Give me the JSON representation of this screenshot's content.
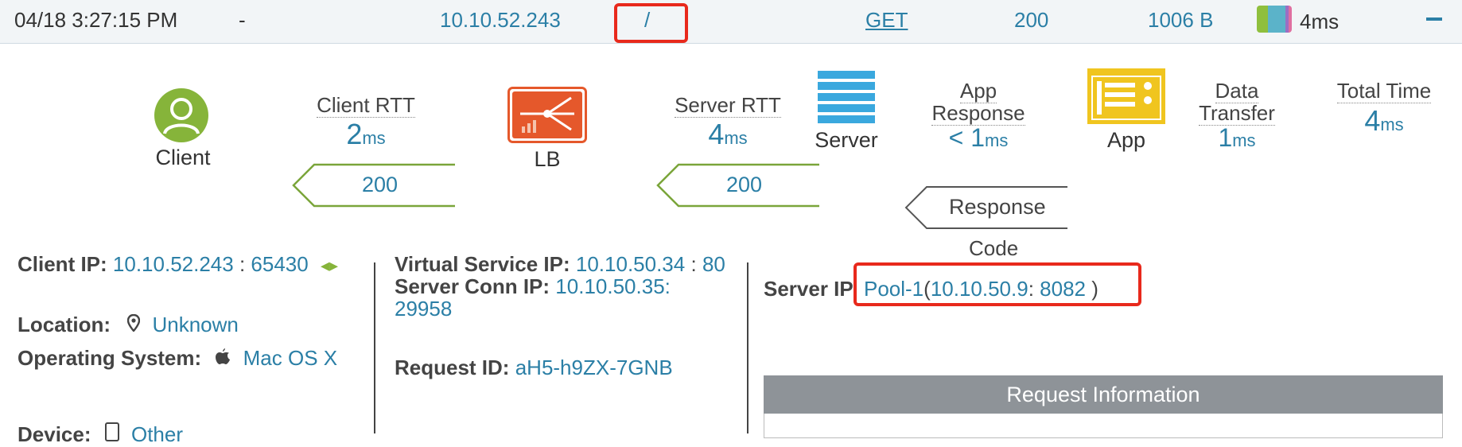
{
  "log_row": {
    "timestamp": "04/18 3:27:15 PM",
    "dash": "-",
    "client_ip": "10.10.52.243",
    "uri": "/",
    "method": "GET",
    "status": "200",
    "size": "1006 B",
    "duration": "4ms",
    "latency_colors": [
      "#8fbf3d",
      "#5bb3c9",
      "#9b6fc4",
      "#e06fa0"
    ]
  },
  "flow": {
    "client_label": "Client",
    "lb_label": "LB",
    "server_label": "Server",
    "app_label": "App",
    "client_rtt": {
      "title": "Client RTT",
      "value": "2",
      "unit": "ms"
    },
    "server_rtt": {
      "title": "Server RTT",
      "value": "4",
      "unit": "ms"
    },
    "app_response": {
      "title_line1": "App",
      "title_line2": "Response",
      "value": "< 1",
      "unit": "ms"
    },
    "data_transfer": {
      "title_line1": "Data",
      "title_line2": "Transfer",
      "value": "1",
      "unit": "ms"
    },
    "total_time": {
      "title": "Total Time",
      "value": "4",
      "unit": "ms"
    },
    "client_code": "200",
    "server_code": "200",
    "response_code_line1": "Response",
    "response_code_line2": "Code"
  },
  "client_info": {
    "client_ip_label": "Client IP:",
    "client_ip": "10.10.52.243",
    "client_port_sep": ":",
    "client_port": "65430",
    "location_label": "Location:",
    "location": "Unknown",
    "os_label": "Operating System:",
    "os": "Mac OS X",
    "device_label": "Device:",
    "device": "Other"
  },
  "vs_info": {
    "vs_ip_label": "Virtual Service IP:",
    "vs_ip": "10.10.50.34",
    "vs_port_sep": ":",
    "vs_port": "80",
    "conn_ip_label": "Server Conn IP:",
    "conn_ip": "10.10.50.35:",
    "conn_port": "29958",
    "request_id_label": "Request ID:",
    "request_id": "aH5-h9ZX-7GNB"
  },
  "server_info": {
    "server_ip_label": "Server IP",
    "pool": "Pool-1",
    "open_paren": "(",
    "server_ip": "10.10.50.9",
    "port_sep": ":",
    "server_port": "8082",
    "close_paren": ")",
    "request_information": "Request Information"
  },
  "colors": {
    "accent": "#2b7fa6",
    "highlight": "#e8291c",
    "lb": "#e5582b",
    "app": "#f0c51f",
    "server": "#3aa8de",
    "client": "#86b43a"
  }
}
